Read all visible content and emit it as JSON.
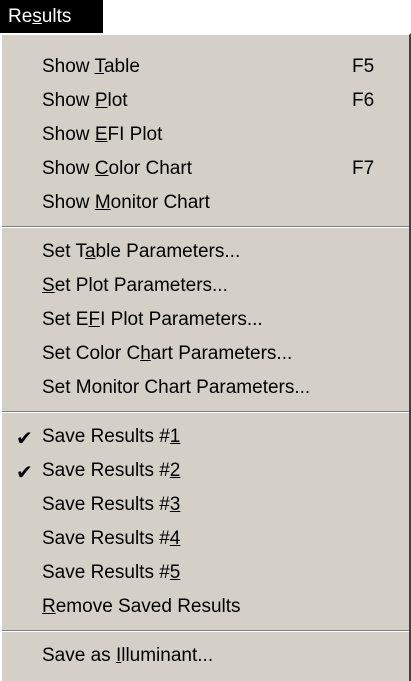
{
  "menubar": {
    "title_pre": "Re",
    "title_u": "s",
    "title_post": "ults"
  },
  "menu": {
    "show_table": {
      "pre": "Show ",
      "u": "T",
      "post": "able",
      "shortcut": "F5"
    },
    "show_plot": {
      "pre": "Show ",
      "u": "P",
      "post": "lot",
      "shortcut": "F6"
    },
    "show_efi": {
      "pre": "Show ",
      "u": "E",
      "post": "FI Plot"
    },
    "show_color": {
      "pre": "Show ",
      "u": "C",
      "post": "olor Chart",
      "shortcut": "F7"
    },
    "show_monitor": {
      "pre": "Show ",
      "u": "M",
      "post": "onitor Chart"
    },
    "set_table": {
      "pre": "Set T",
      "u": "a",
      "post": "ble Parameters..."
    },
    "set_plot": {
      "pre": "",
      "u": "S",
      "post": "et Plot Parameters..."
    },
    "set_efi": {
      "pre": "Set E",
      "u": "F",
      "post": "I Plot Parameters..."
    },
    "set_color": {
      "pre": "Set Color C",
      "u": "h",
      "post": "art Parameters..."
    },
    "set_monitor": {
      "pre": "Set Monitor Chart Parameters...",
      "u": "",
      "post": ""
    },
    "save1": {
      "pre": "Save Results #",
      "u": "1",
      "post": "",
      "check": "✔"
    },
    "save2": {
      "pre": "Save Results #",
      "u": "2",
      "post": "",
      "check": "✔"
    },
    "save3": {
      "pre": "Save Results #",
      "u": "3",
      "post": ""
    },
    "save4": {
      "pre": "Save Results #",
      "u": "4",
      "post": ""
    },
    "save5": {
      "pre": "Save Results #",
      "u": "5",
      "post": ""
    },
    "remove": {
      "pre": "",
      "u": "R",
      "post": "emove Saved Results"
    },
    "illuminant": {
      "pre": "Save as ",
      "u": "I",
      "post": "lluminant..."
    }
  }
}
